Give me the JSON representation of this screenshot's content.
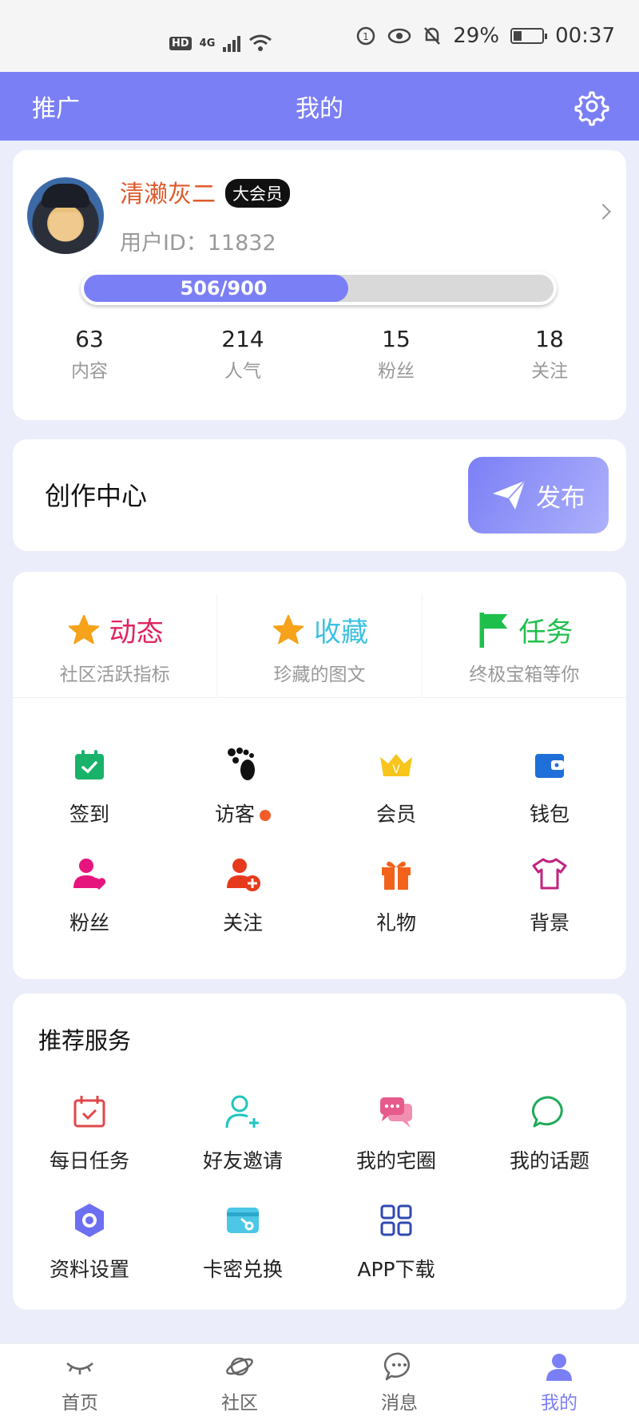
{
  "status_bar": {
    "hd": "HD",
    "network": "4G",
    "battery_text": "29%",
    "time": "00:37"
  },
  "header": {
    "left_label": "推广",
    "title": "我的",
    "settings_icon": "gear-icon"
  },
  "profile": {
    "username": "清濑灰二",
    "badge": "大会员",
    "user_id": "用户ID：11832",
    "progress_text": "506/900",
    "progress_value": 506,
    "progress_max": 900,
    "stats": [
      {
        "value": "63",
        "label": "内容"
      },
      {
        "value": "214",
        "label": "人气"
      },
      {
        "value": "15",
        "label": "粉丝"
      },
      {
        "value": "18",
        "label": "关注"
      }
    ]
  },
  "creation": {
    "title": "创作中心",
    "publish_label": "发布"
  },
  "features": {
    "highlights": [
      {
        "label": "动态",
        "sub": "社区活跃指标",
        "color": "#e0245e",
        "icon": "star-icon"
      },
      {
        "label": "收藏",
        "sub": "珍藏的图文",
        "color": "#3ec1e0",
        "icon": "star-icon"
      },
      {
        "label": "任务",
        "sub": "终极宝箱等你",
        "color": "#1fbf4c",
        "icon": "flag-icon"
      }
    ],
    "grid": [
      {
        "label": "签到",
        "icon": "calendar-check-icon"
      },
      {
        "label": "访客",
        "icon": "footprints-icon"
      },
      {
        "label": "会员",
        "icon": "crown-icon"
      },
      {
        "label": "钱包",
        "icon": "wallet-icon"
      },
      {
        "label": "粉丝",
        "icon": "user-heart-icon"
      },
      {
        "label": "关注",
        "icon": "user-add-icon"
      },
      {
        "label": "礼物",
        "icon": "gift-icon"
      },
      {
        "label": "背景",
        "icon": "shirt-icon"
      }
    ]
  },
  "services": {
    "title": "推荐服务",
    "items": [
      {
        "label": "每日任务",
        "icon": "task-calendar-icon"
      },
      {
        "label": "好友邀请",
        "icon": "invite-user-icon"
      },
      {
        "label": "我的宅圈",
        "icon": "chat-bubbles-icon"
      },
      {
        "label": "我的话题",
        "icon": "speech-bubble-icon"
      },
      {
        "label": "资料设置",
        "icon": "hexagon-settings-icon"
      },
      {
        "label": "卡密兑换",
        "icon": "card-key-icon"
      },
      {
        "label": "APP下载",
        "icon": "apps-grid-icon"
      }
    ]
  },
  "tabbar": {
    "tabs": [
      {
        "label": "首页",
        "icon": "eye-closed-icon"
      },
      {
        "label": "社区",
        "icon": "planet-icon"
      },
      {
        "label": "消息",
        "icon": "message-icon"
      },
      {
        "label": "我的",
        "icon": "user-icon"
      }
    ],
    "active_index": 3,
    "accent": "#7b7ff5"
  }
}
